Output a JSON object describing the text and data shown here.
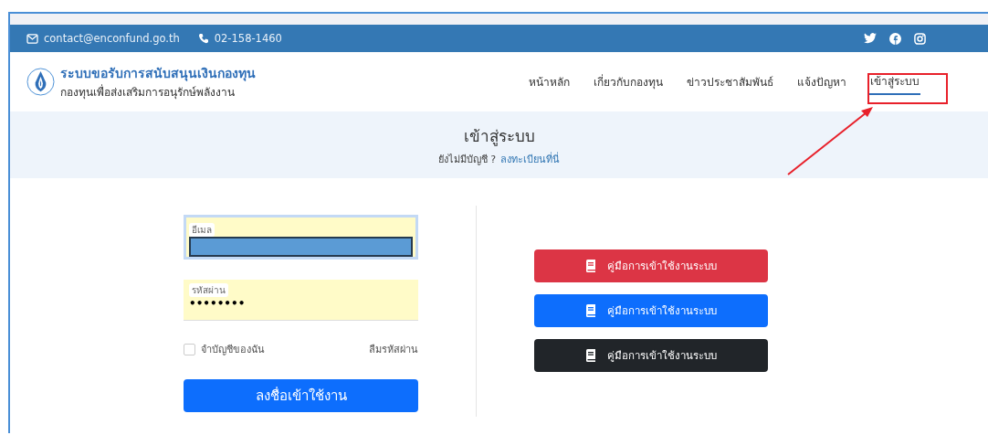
{
  "top_bar": {
    "email": "contact@enconfund.go.th",
    "phone": "02-158-1460"
  },
  "brand": {
    "title": "ระบบขอรับการสนับสนุนเงินกองทุน",
    "subtitle": "กองทุนเพื่อส่งเสริมการอนุรักษ์พลังงาน"
  },
  "nav": [
    {
      "label": "หน้าหลัก",
      "selected": false
    },
    {
      "label": "เกี่ยวกับกองทุน",
      "selected": false
    },
    {
      "label": "ข่าวประชาสัมพันธ์",
      "selected": false
    },
    {
      "label": "แจ้งปัญหา",
      "selected": false
    },
    {
      "label": "เข้าสู่ระบบ",
      "selected": true
    }
  ],
  "hero": {
    "title": "เข้าสู่ระบบ",
    "prompt": "ยังไม่มีบัญชี ?",
    "link": "ลงทะเบียนที่นี่"
  },
  "login_form": {
    "email_label": "อีเมล",
    "password_label": "รหัสผ่าน",
    "password_value": "••••••••",
    "remember_label": "จำบัญชีของฉัน",
    "remember_checked": false,
    "forgot_link": "ลืมรหัสผ่าน",
    "submit": "ลงชื่อเข้าใช้งาน"
  },
  "manual_buttons": [
    {
      "label": "คู่มือการเข้าใช้งานระบบ",
      "color": "#dc3545"
    },
    {
      "label": "คู่มือการเข้าใช้งานระบบ",
      "color": "#0d6efd"
    },
    {
      "label": "คู่มือการเข้าใช้งานระบบ",
      "color": "#212529"
    }
  ]
}
